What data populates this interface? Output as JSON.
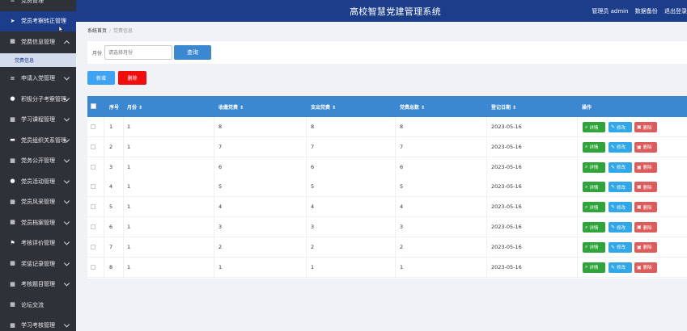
{
  "sidebar": {
    "items": [
      {
        "label": "党员管理",
        "icon": "list-icon",
        "chev": "none"
      },
      {
        "label": "党员考察转正管理",
        "icon": "send-icon",
        "chev": "none"
      },
      {
        "label": "党费信息管理",
        "icon": "grid-icon",
        "chev": "up"
      },
      {
        "label": "申请入党管理",
        "icon": "list-icon",
        "chev": "down"
      },
      {
        "label": "积极分子考察管理",
        "icon": "pin-icon",
        "chev": "down"
      },
      {
        "label": "学习课程管理",
        "icon": "grid-icon",
        "chev": "down"
      },
      {
        "label": "党员组织关系管理",
        "icon": "chat-icon",
        "chev": "down"
      },
      {
        "label": "党务公开管理",
        "icon": "grid-icon",
        "chev": "down"
      },
      {
        "label": "党员活动管理",
        "icon": "user-icon",
        "chev": "down"
      },
      {
        "label": "党员风采管理",
        "icon": "grid-icon",
        "chev": "down"
      },
      {
        "label": "党员档案管理",
        "icon": "grid-icon",
        "chev": "down"
      },
      {
        "label": "考核评价管理",
        "icon": "flag-icon",
        "chev": "down"
      },
      {
        "label": "奖惩记录管理",
        "icon": "grid-icon",
        "chev": "down"
      },
      {
        "label": "考核题目管理",
        "icon": "grid-icon",
        "chev": "down"
      },
      {
        "label": "论坛交流",
        "icon": "grid-icon",
        "chev": "none"
      },
      {
        "label": "学习考核管理",
        "icon": "grid-icon",
        "chev": "down"
      }
    ],
    "sub_item": "党费信息"
  },
  "header": {
    "title": "高校智慧党建管理系统",
    "admin": "管理员 admin",
    "backup": "数据备份",
    "logout": "退出登录"
  },
  "breadcrumb": {
    "home": "系统首页",
    "current": "党费信息"
  },
  "search": {
    "label": "月份",
    "placeholder": "请选择月份",
    "button": "查询"
  },
  "actions": {
    "add": "新增",
    "delete": "删除"
  },
  "table": {
    "headers": [
      "序号",
      "月份",
      "收缴党费",
      "支出党费",
      "党费总数",
      "登记日期",
      "操作"
    ],
    "rows": [
      {
        "no": "1",
        "month": "1",
        "collected": "8",
        "spent": "8",
        "total": "8",
        "date": "2023-05-16"
      },
      {
        "no": "2",
        "month": "1",
        "collected": "7",
        "spent": "7",
        "total": "7",
        "date": "2023-05-16"
      },
      {
        "no": "3",
        "month": "1",
        "collected": "6",
        "spent": "6",
        "total": "6",
        "date": "2023-05-16"
      },
      {
        "no": "4",
        "month": "1",
        "collected": "5",
        "spent": "5",
        "total": "5",
        "date": "2023-05-16"
      },
      {
        "no": "5",
        "month": "1",
        "collected": "4",
        "spent": "4",
        "total": "4",
        "date": "2023-05-16"
      },
      {
        "no": "6",
        "month": "1",
        "collected": "3",
        "spent": "3",
        "total": "3",
        "date": "2023-05-16"
      },
      {
        "no": "7",
        "month": "1",
        "collected": "2",
        "spent": "2",
        "total": "2",
        "date": "2023-05-16"
      },
      {
        "no": "8",
        "month": "1",
        "collected": "1",
        "spent": "1",
        "total": "1",
        "date": "2023-05-16"
      }
    ],
    "row_buttons": {
      "detail": "详情",
      "edit": "修改",
      "delete": "删除"
    }
  },
  "colors": {
    "header": "#1b3d8a",
    "sidebar": "#2e3238",
    "table_head": "#3c88d0",
    "detail": "#2fa43a",
    "edit": "#2fa7e8",
    "delete": "#dc5c5c"
  }
}
